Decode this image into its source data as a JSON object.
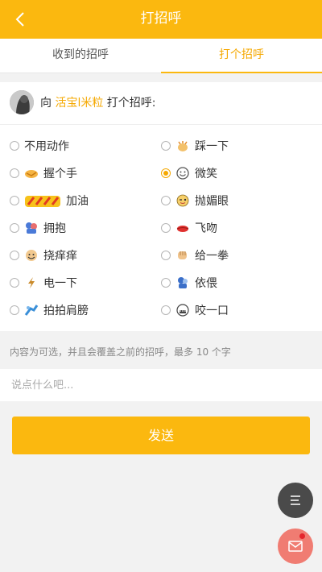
{
  "header": {
    "title": "打招呼",
    "back_icon": "chevron-left-icon"
  },
  "tabs": [
    {
      "label": "收到的招呼",
      "active": false
    },
    {
      "label": "打个招呼",
      "active": true
    }
  ],
  "greeting": {
    "prefix": "向 ",
    "nickname": "活宝l米粒",
    "suffix": " 打个招呼:"
  },
  "actions": {
    "left": [
      {
        "label": "不用动作",
        "icon": "",
        "selected": false
      },
      {
        "label": "握个手",
        "icon": "handshake-icon",
        "selected": false
      },
      {
        "label": "加油",
        "icon": "jiayou-sticker-icon",
        "selected": false
      },
      {
        "label": "拥抱",
        "icon": "hug-icon",
        "selected": false
      },
      {
        "label": "挠痒痒",
        "icon": "tickle-icon",
        "selected": false
      },
      {
        "label": "电一下",
        "icon": "lightning-icon",
        "selected": false
      },
      {
        "label": "拍拍肩膀",
        "icon": "pat-shoulder-icon",
        "selected": false
      }
    ],
    "right": [
      {
        "label": "踩一下",
        "icon": "stomp-icon",
        "selected": false
      },
      {
        "label": "微笑",
        "icon": "smile-icon",
        "selected": true
      },
      {
        "label": "抛媚眼",
        "icon": "wink-icon",
        "selected": false
      },
      {
        "label": "飞吻",
        "icon": "kiss-icon",
        "selected": false
      },
      {
        "label": "给一拳",
        "icon": "punch-icon",
        "selected": false
      },
      {
        "label": "依偎",
        "icon": "cuddle-icon",
        "selected": false
      },
      {
        "label": "咬一口",
        "icon": "bite-icon",
        "selected": false
      }
    ]
  },
  "hint": "内容为可选，并且会覆盖之前的招呼，最多 10 个字",
  "message_input": {
    "placeholder": "说点什么吧...",
    "value": ""
  },
  "send_button": "发送",
  "fab": {
    "menu_icon": "menu-icon",
    "mail_icon": "mail-icon",
    "mail_unread": true
  },
  "colors": {
    "accent": "#fbb80f",
    "selected": "#f5a800",
    "mail_fab": "#f07c72",
    "menu_fab": "#4a4a4a"
  }
}
